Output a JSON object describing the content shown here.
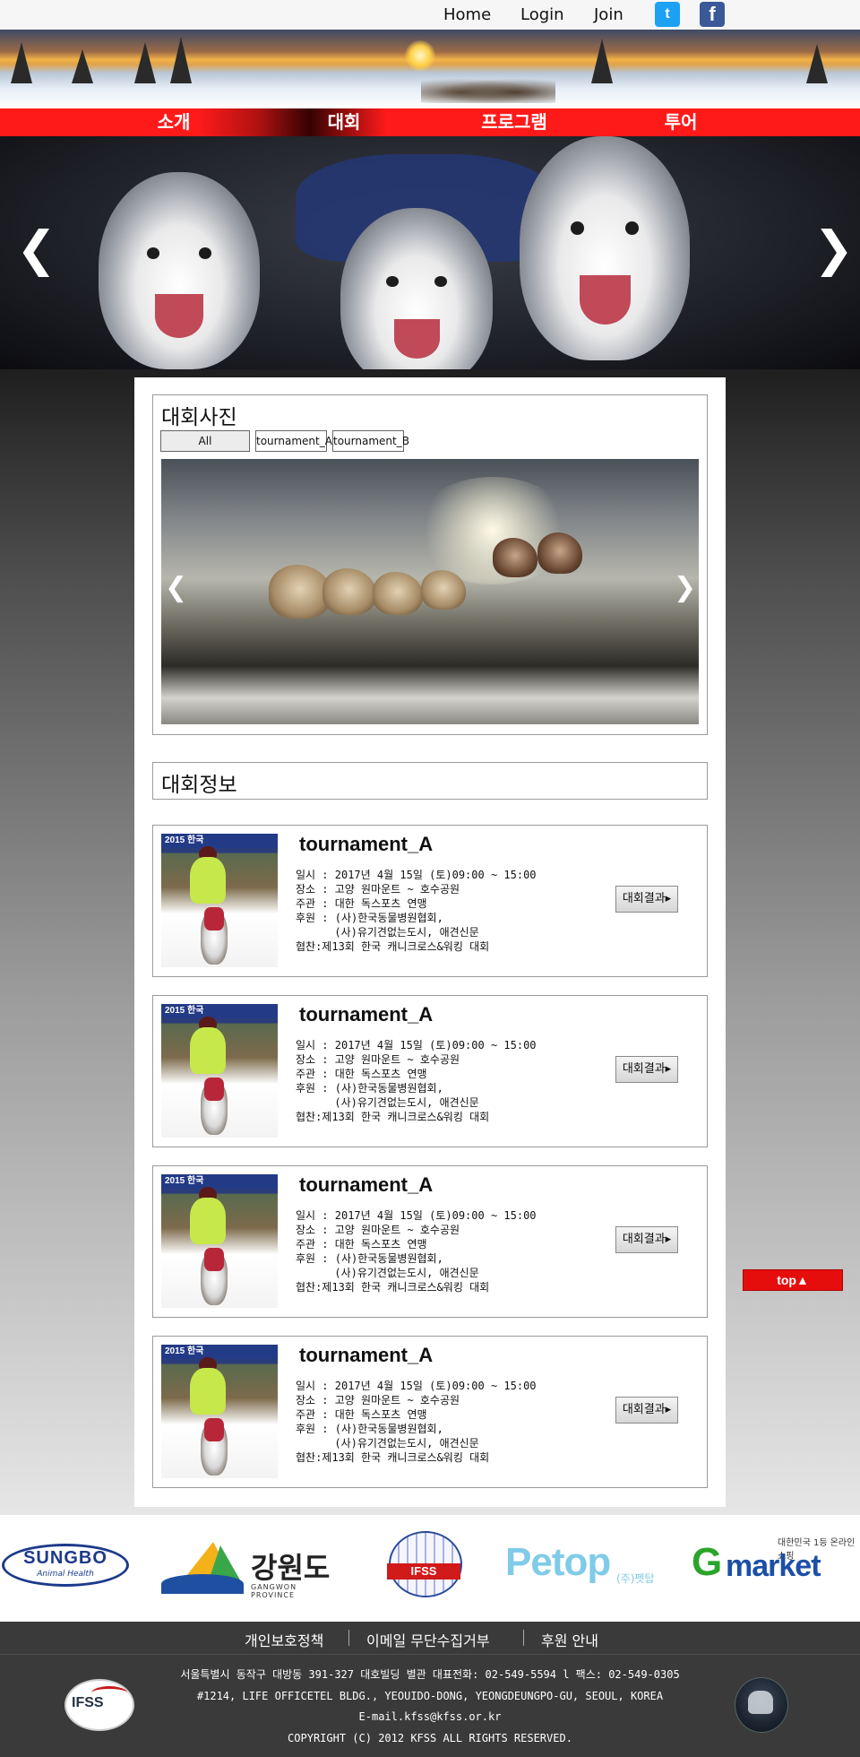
{
  "topnav": {
    "home": "Home",
    "login": "Login",
    "join": "Join",
    "twitter_icon": "t",
    "facebook_icon": "f"
  },
  "menu": [
    "소개",
    "대회",
    "프로그램",
    "투어"
  ],
  "hero": {
    "prev": "❮",
    "next": "❯"
  },
  "gallery": {
    "title": "대회사진",
    "tabs": [
      "All",
      "tournament_A",
      "tournament_B"
    ],
    "prev": "❮",
    "next": "❯"
  },
  "info": {
    "title": "대회정보",
    "cards": [
      {
        "title": "tournament_A",
        "lines": [
          "일시 : 2017년 4월 15일 (토)09:00 ~ 15:00",
          "장소 : 고양 원마운트 ~ 호수공원",
          "주관 : 대한 독스포츠 연맹",
          "후원 : (사)한국동물병원협회,",
          "      (사)유기견없는도시, 애견신문",
          "협찬:제13회 한국 캐니크로스&워킹 대회"
        ],
        "button": "대회결과▸",
        "thumb_banner": "2015 한국"
      },
      {
        "title": "tournament_A",
        "lines": [
          "일시 : 2017년 4월 15일 (토)09:00 ~ 15:00",
          "장소 : 고양 원마운트 ~ 호수공원",
          "주관 : 대한 독스포츠 연맹",
          "후원 : (사)한국동물병원협회,",
          "      (사)유기견없는도시, 애견신문",
          "협찬:제13회 한국 캐니크로스&워킹 대회"
        ],
        "button": "대회결과▸",
        "thumb_banner": "2015 한국"
      },
      {
        "title": "tournament_A",
        "lines": [
          "일시 : 2017년 4월 15일 (토)09:00 ~ 15:00",
          "장소 : 고양 원마운트 ~ 호수공원",
          "주관 : 대한 독스포츠 연맹",
          "후원 : (사)한국동물병원협회,",
          "      (사)유기견없는도시, 애견신문",
          "협찬:제13회 한국 캐니크로스&워킹 대회"
        ],
        "button": "대회결과▸",
        "thumb_banner": "2015 한국"
      },
      {
        "title": "tournament_A",
        "lines": [
          "일시 : 2017년 4월 15일 (토)09:00 ~ 15:00",
          "장소 : 고양 원마운트 ~ 호수공원",
          "주관 : 대한 독스포츠 연맹",
          "후원 : (사)한국동물병원협회,",
          "      (사)유기견없는도시, 애견신문",
          "협찬:제13회 한국 캐니크로스&워킹 대회"
        ],
        "button": "대회결과▸",
        "thumb_banner": "2015 한국"
      }
    ]
  },
  "top_button": "top▲",
  "sponsors": {
    "sungbo": {
      "name": "SUNGBO",
      "sub": "Animal Health"
    },
    "gangwon": {
      "name": "강원도",
      "sub": "GANGWON PROVINCE"
    },
    "ifss": {
      "name": "IFSS"
    },
    "petop": {
      "name": "Petop",
      "sub": "(주)펫탑"
    },
    "gmarket": {
      "tag": "대한민국 1등 온라인 쇼핑",
      "g": "G",
      "name": "market"
    }
  },
  "footer": {
    "links": [
      "개인보호정책",
      "이메일 무단수집거부",
      "후원 안내"
    ],
    "info": [
      "서울특별시 동작구 대방동 391-327 대호빌딩 별관 대표전화: 02-549-5594 l 팩스: 02-549-0305",
      "#1214, LIFE OFFICETEL BLDG., YEOUIDO-DONG, YEONGDEUNGPO-GU, SEOUL, KOREA",
      "E-mail.kfss@kfss.or.kr",
      "COPYRIGHT (C) 2012 KFSS ALL RIGHTS RESERVED."
    ],
    "left_logo": "IFSS"
  }
}
